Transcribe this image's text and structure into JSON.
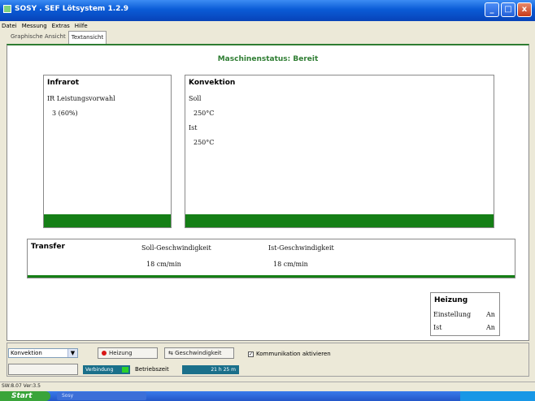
{
  "window": {
    "title": "SOSY . SEF Lötsystem  1.2.9",
    "buttons": [
      "_",
      "□",
      "x"
    ]
  },
  "menu": [
    "Datei",
    "Messung",
    "Extras",
    "Hilfe"
  ],
  "tabs": [
    {
      "label": "Graphische Ansicht",
      "active": false
    },
    {
      "label": "Textansicht",
      "active": true
    }
  ],
  "status": "Maschinenstatus: Bereit",
  "infrarot": {
    "title": "Infrarot",
    "label": "IR Leistungsvorwahl",
    "value": "3 (60%)"
  },
  "konvektion": {
    "title": "Konvektion",
    "soll_label": "Soll",
    "soll_value": "250°C",
    "ist_label": "Ist",
    "ist_value": "250°C"
  },
  "transfer": {
    "title": "Transfer",
    "soll_label": "Soll-Geschwindigkeit",
    "soll_value": "18 cm/min",
    "ist_label": "Ist-Geschwindigkeit",
    "ist_value": "18 cm/min"
  },
  "heizung": {
    "title": "Heizung",
    "einstellung_label": "Einstellung",
    "einstellung_value": "An",
    "ist_label": "Ist",
    "ist_value": "An"
  },
  "controls": {
    "mode_select": "Konvektion",
    "heizung_btn": "Heizung",
    "geschwindigkeit_btn": "Geschwindigkeit",
    "kommunikation_label": "Kommunikation aktivieren",
    "kommunikation_checked": true,
    "disabled_btn": "",
    "ready_indicator": "Verbindung",
    "betriebszeit_label": "Betriebszeit",
    "betriebszeit_value": "21 h 25 m"
  },
  "statusbar": "SW:8.07 Ver:3.5",
  "taskbar": {
    "start": "Start",
    "task": "Sosy",
    "clock": ""
  },
  "colors": {
    "accent_green": "#157f16",
    "status_green": "#2e7d32"
  }
}
